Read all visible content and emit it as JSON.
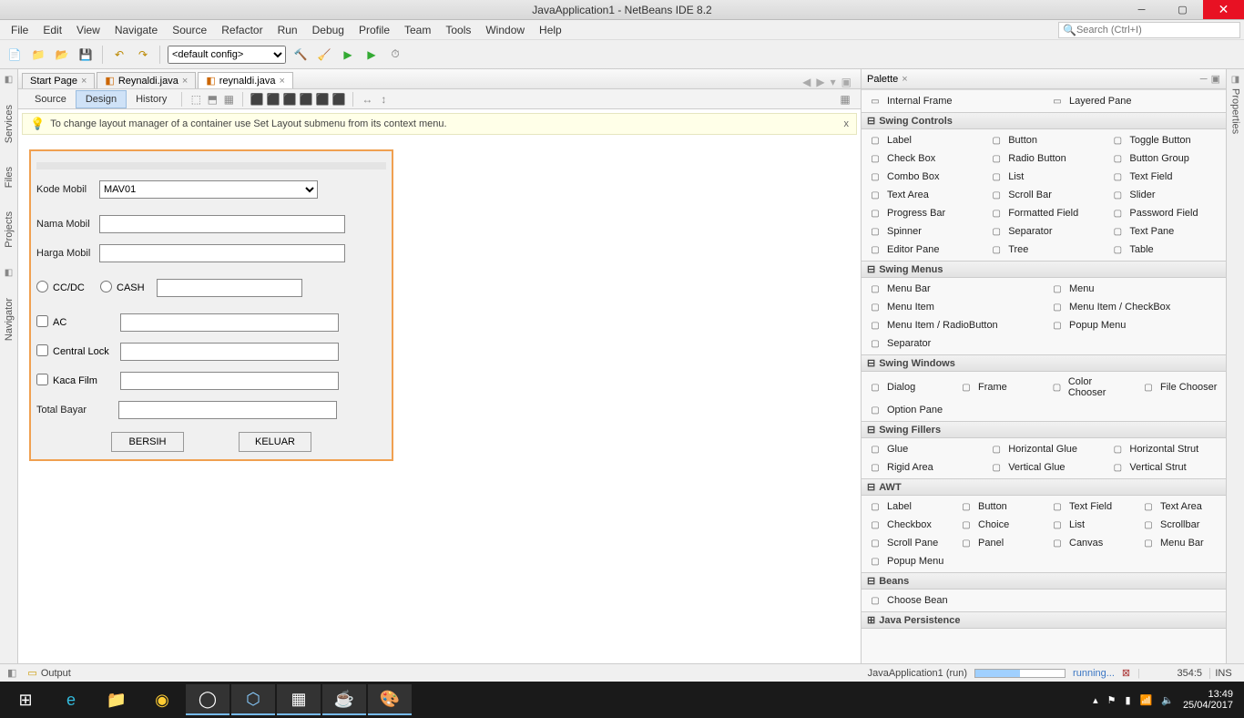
{
  "window": {
    "title": "JavaApplication1 - NetBeans IDE 8.2"
  },
  "menu": {
    "items": [
      "File",
      "Edit",
      "View",
      "Navigate",
      "Source",
      "Refactor",
      "Run",
      "Debug",
      "Profile",
      "Team",
      "Tools",
      "Window",
      "Help"
    ],
    "search_placeholder": "Search (Ctrl+I)"
  },
  "toolbar": {
    "config": "<default config>"
  },
  "left_tabs": [
    "Services",
    "Files",
    "Projects",
    "Navigator"
  ],
  "right_tab": "Properties",
  "editor_tabs": [
    {
      "label": "Start Page",
      "active": false
    },
    {
      "label": "Reynaldi.java",
      "active": false
    },
    {
      "label": "reynaldi.java",
      "active": true
    }
  ],
  "modes": {
    "source": "Source",
    "design": "Design",
    "history": "History",
    "active": "Design"
  },
  "hint": {
    "text": "To change layout manager of a container use Set Layout submenu from its context menu.",
    "close": "x"
  },
  "form": {
    "kode_label": "Kode Mobil",
    "kode_value": "MAV01",
    "nama_label": "Nama Mobil",
    "nama_value": "",
    "harga_label": "Harga Mobil",
    "harga_value": "",
    "ccdc": "CC/DC",
    "cash": "CASH",
    "pay_value": "",
    "ac": "AC",
    "ac_value": "",
    "central": "Central Lock",
    "central_value": "",
    "kaca": "Kaca Film",
    "kaca_value": "",
    "total_label": "Total Bayar",
    "total_value": "",
    "bersih": "BERSIH",
    "keluar": "KELUAR"
  },
  "palette": {
    "title": "Palette",
    "groups": {
      "topitems": [
        {
          "l": "Internal Frame"
        },
        {
          "l": "Layered Pane"
        }
      ],
      "swing_controls": "Swing Controls",
      "controls": [
        {
          "l": "Label"
        },
        {
          "l": "Button"
        },
        {
          "l": "Toggle Button"
        },
        {
          "l": "Check Box"
        },
        {
          "l": "Radio Button"
        },
        {
          "l": "Button Group"
        },
        {
          "l": "Combo Box"
        },
        {
          "l": "List"
        },
        {
          "l": "Text Field"
        },
        {
          "l": "Text Area"
        },
        {
          "l": "Scroll Bar"
        },
        {
          "l": "Slider"
        },
        {
          "l": "Progress Bar"
        },
        {
          "l": "Formatted Field"
        },
        {
          "l": "Password Field"
        },
        {
          "l": "Spinner"
        },
        {
          "l": "Separator"
        },
        {
          "l": "Text Pane"
        },
        {
          "l": "Editor Pane"
        },
        {
          "l": "Tree"
        },
        {
          "l": "Table"
        }
      ],
      "swing_menus": "Swing Menus",
      "menus": [
        {
          "l": "Menu Bar"
        },
        {
          "l": "Menu"
        },
        {
          "l": "Menu Item"
        },
        {
          "l": "Menu Item / CheckBox"
        },
        {
          "l": "Menu Item / RadioButton"
        },
        {
          "l": "Popup Menu"
        },
        {
          "l": "Separator"
        }
      ],
      "swing_windows": "Swing Windows",
      "windows": [
        {
          "l": "Dialog"
        },
        {
          "l": "Frame"
        },
        {
          "l": "Color Chooser"
        },
        {
          "l": "File Chooser"
        },
        {
          "l": "Option Pane"
        }
      ],
      "swing_fillers": "Swing Fillers",
      "fillers": [
        {
          "l": "Glue"
        },
        {
          "l": "Horizontal Glue"
        },
        {
          "l": "Horizontal Strut"
        },
        {
          "l": "Rigid Area"
        },
        {
          "l": "Vertical Glue"
        },
        {
          "l": "Vertical Strut"
        }
      ],
      "awt": "AWT",
      "awts": [
        {
          "l": "Label"
        },
        {
          "l": "Button"
        },
        {
          "l": "Text Field"
        },
        {
          "l": "Text Area"
        },
        {
          "l": "Checkbox"
        },
        {
          "l": "Choice"
        },
        {
          "l": "List"
        },
        {
          "l": "Scrollbar"
        },
        {
          "l": "Scroll Pane"
        },
        {
          "l": "Panel"
        },
        {
          "l": "Canvas"
        },
        {
          "l": "Menu Bar"
        },
        {
          "l": "Popup Menu"
        }
      ],
      "beans": "Beans",
      "beanitems": [
        {
          "l": "Choose Bean"
        }
      ],
      "persistence": "Java Persistence"
    }
  },
  "status": {
    "output": "Output",
    "app": "JavaApplication1 (run)",
    "running": "running...",
    "caret": "354:5",
    "ins": "INS"
  },
  "system": {
    "time": "13:49",
    "date": "25/04/2017"
  }
}
